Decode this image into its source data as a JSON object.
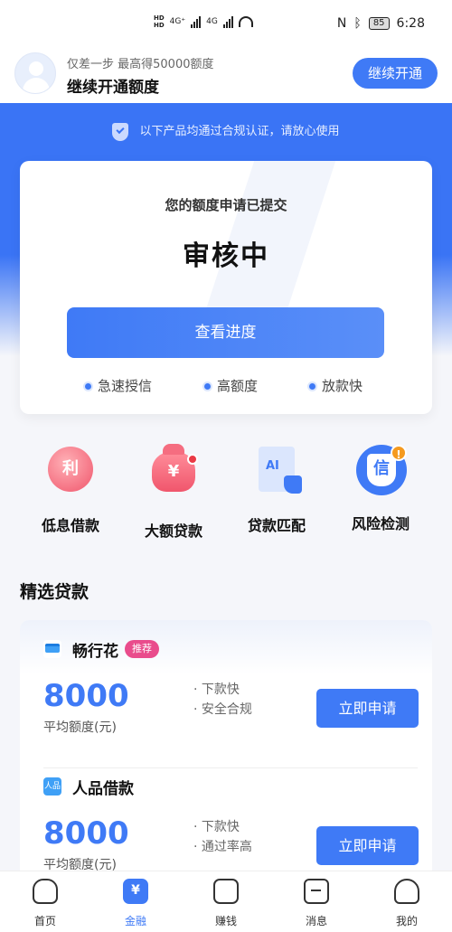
{
  "status_bar": {
    "network1": "4G⁺",
    "network2": "4G",
    "hd1": "HD",
    "hd2": "HD",
    "battery": "85",
    "time": "6:28"
  },
  "header": {
    "hint": "仅差一步 最高得50000额度",
    "title": "继续开通额度",
    "button": "继续开通"
  },
  "banner": {
    "compliance": "以下产品均通过合规认证，请放心使用"
  },
  "apply_card": {
    "subtitle": "您的额度申请已提交",
    "status": "审核中",
    "button": "查看进度",
    "features": [
      "急速授信",
      "高额度",
      "放款快"
    ]
  },
  "quick_entries": [
    {
      "label": "低息借款",
      "icon": "coin-li-icon",
      "glyph": "利"
    },
    {
      "label": "大额贷款",
      "icon": "money-bag-icon",
      "glyph": "¥"
    },
    {
      "label": "贷款匹配",
      "icon": "ai-match-icon",
      "glyph": "AI"
    },
    {
      "label": "风险检测",
      "icon": "credit-shield-icon",
      "glyph": "信",
      "alert": "!"
    }
  ],
  "section": {
    "title": "精选贷款"
  },
  "loans": [
    {
      "name": "畅行花",
      "tag": "推荐",
      "amount": "8000",
      "amount_label": "平均额度(元)",
      "features": [
        "· 下款快",
        "· 安全合规"
      ],
      "button": "立即申请"
    },
    {
      "name": "人品借款",
      "tag": "",
      "amount": "8000",
      "amount_label": "平均额度(元)",
      "features": [
        "· 下款快",
        "· 通过率高"
      ],
      "button": "立即申请"
    }
  ],
  "tabbar": {
    "items": [
      {
        "label": "首页",
        "active": false
      },
      {
        "label": "金融",
        "active": true,
        "glyph": "¥"
      },
      {
        "label": "赚钱",
        "active": false
      },
      {
        "label": "消息",
        "active": false
      },
      {
        "label": "我的",
        "active": false
      }
    ]
  },
  "colors": {
    "primary": "#3f7af6",
    "tag": "#e94c8c",
    "alert_red": "#ea3a45",
    "warn": "#f59a1f"
  }
}
